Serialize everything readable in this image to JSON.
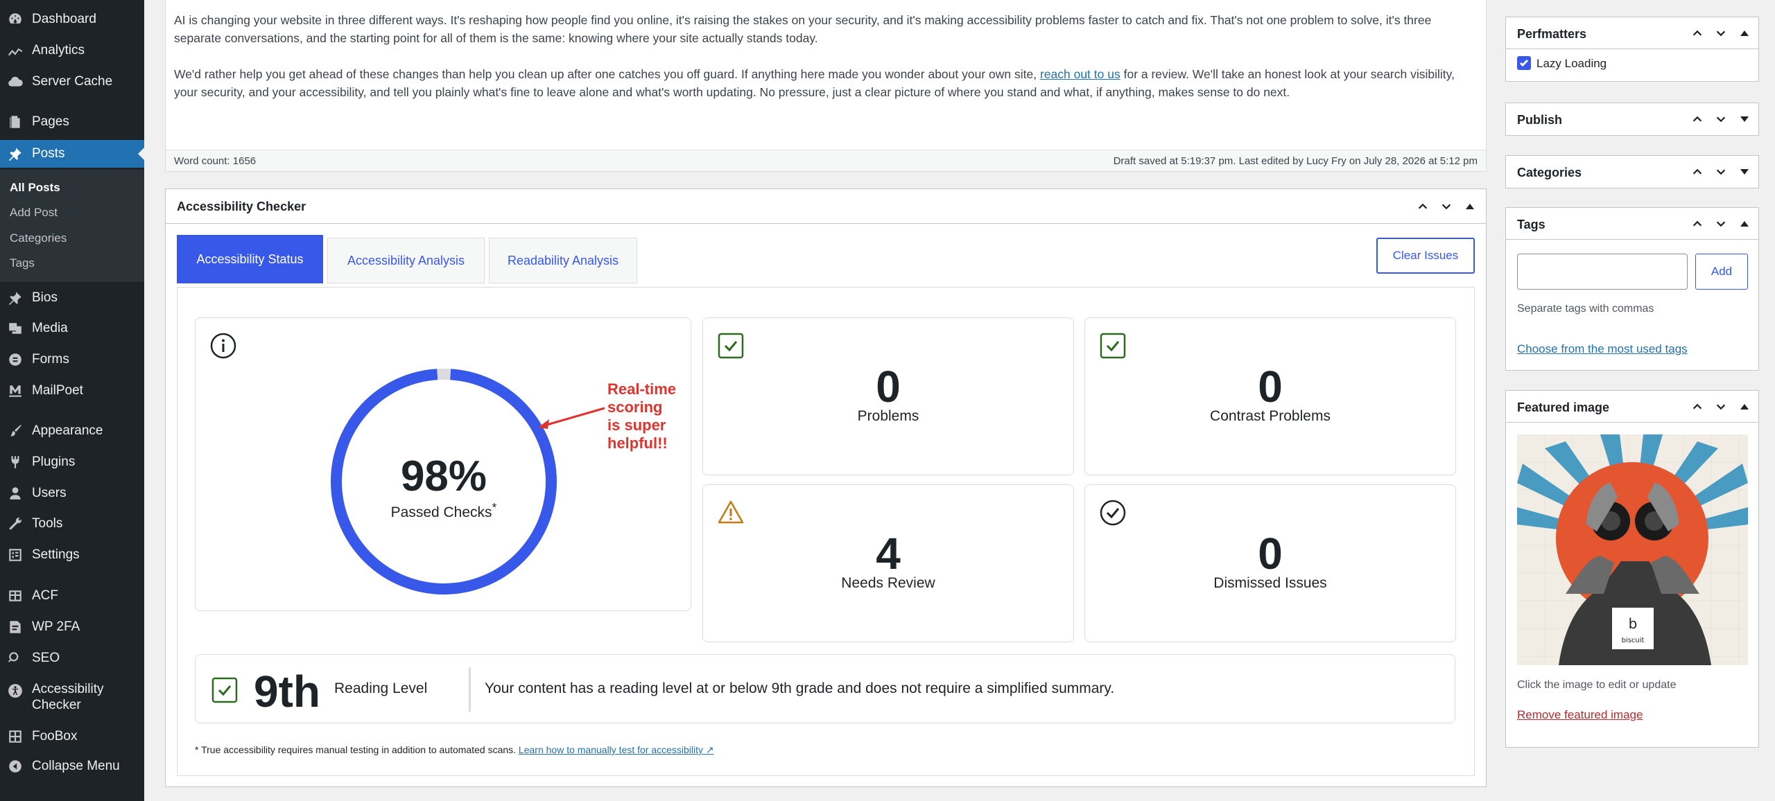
{
  "admin_menu": {
    "items": [
      {
        "label": "Dashboard",
        "icon": "dashboard-icon"
      },
      {
        "label": "Analytics",
        "icon": "analytics-icon"
      },
      {
        "label": "Server Cache",
        "icon": "cloud-icon"
      },
      {
        "label": "Pages",
        "icon": "pages-icon"
      },
      {
        "label": "Posts",
        "icon": "pin-icon"
      },
      {
        "label": "Bios",
        "icon": "pin-icon"
      },
      {
        "label": "Media",
        "icon": "media-icon"
      },
      {
        "label": "Forms",
        "icon": "forms-icon"
      },
      {
        "label": "MailPoet",
        "icon": "mailpoet-icon"
      },
      {
        "label": "Appearance",
        "icon": "brush-icon"
      },
      {
        "label": "Plugins",
        "icon": "plugin-icon"
      },
      {
        "label": "Users",
        "icon": "user-icon"
      },
      {
        "label": "Tools",
        "icon": "wrench-icon"
      },
      {
        "label": "Settings",
        "icon": "settings-icon"
      },
      {
        "label": "ACF",
        "icon": "acf-icon"
      },
      {
        "label": "WP 2FA",
        "icon": "shield-icon"
      },
      {
        "label": "SEO",
        "icon": "seo-icon"
      },
      {
        "label": "Accessibility Checker",
        "icon": "accessibility-icon"
      },
      {
        "label": "FooBox",
        "icon": "grid-icon"
      },
      {
        "label": "Collapse Menu",
        "icon": "collapse-icon"
      }
    ],
    "submenu": [
      "All Posts",
      "Add Post",
      "Categories",
      "Tags"
    ]
  },
  "editor": {
    "para1": "AI is changing your website in three different ways. It's reshaping how people find you online, it's raising the stakes on your security, and it's making accessibility problems faster to catch and fix. That's not one problem to solve, it's three separate conversations, and the starting point for all of them is the same: knowing where your site actually stands today.",
    "para2_before": "We'd rather help you get ahead of these changes than help you clean up after one catches you off guard. If anything here made you wonder about your own site, ",
    "para2_link": "reach out to us",
    "para2_after": " for a review. We'll take an honest look at your search visibility, your security, and your accessibility, and tell you plainly what's fine to leave alone and what's worth updating. No pressure, just a clear picture of where you stand and what, if anything, makes sense to do next.",
    "word_count": "Word count: 1656",
    "draft_status": "Draft saved at 5:19:37 pm. Last edited by Lucy Fry on July 28, 2026 at 5:12 pm"
  },
  "a11y": {
    "title": "Accessibility Checker",
    "tabs": [
      "Accessibility Status",
      "Accessibility Analysis",
      "Readability Analysis"
    ],
    "clear_label": "Clear Issues",
    "score": "98%",
    "score_fraction": 0.98,
    "score_label": "Passed Checks",
    "score_marker": "*",
    "annotation_line1": "Real-time scoring",
    "annotation_line2": "is super helpful!!",
    "cards": [
      {
        "value": "0",
        "label": "Problems"
      },
      {
        "value": "0",
        "label": "Contrast Problems"
      },
      {
        "value": "4",
        "label": "Needs Review"
      },
      {
        "value": "0",
        "label": "Dismissed Issues"
      }
    ],
    "reading_grade": "9th",
    "reading_label": "Reading Level",
    "reading_desc": "Your content has a reading level at or below 9th grade and does not require a simplified summary.",
    "footnote": "* True accessibility requires manual testing in addition to automated scans.",
    "footnote_link": "Learn how to manually test for accessibility ↗",
    "colors": {
      "accent": "#3858e9",
      "success": "#2b6a1f",
      "warning": "#c27b14",
      "annotation": "#e0332d"
    }
  },
  "sidebar": {
    "perfmatters": {
      "title": "Perfmatters",
      "checkbox_label": "Lazy Loading",
      "checked": true
    },
    "publish": {
      "title": "Publish"
    },
    "categories": {
      "title": "Categories"
    },
    "tags": {
      "title": "Tags",
      "add_label": "Add",
      "help": "Separate tags with commas",
      "most_used": "Choose from the most used tags"
    },
    "featured": {
      "title": "Featured image",
      "help": "Click the image to edit or update",
      "remove": "Remove featured image",
      "logo_text": "biscuit"
    }
  }
}
